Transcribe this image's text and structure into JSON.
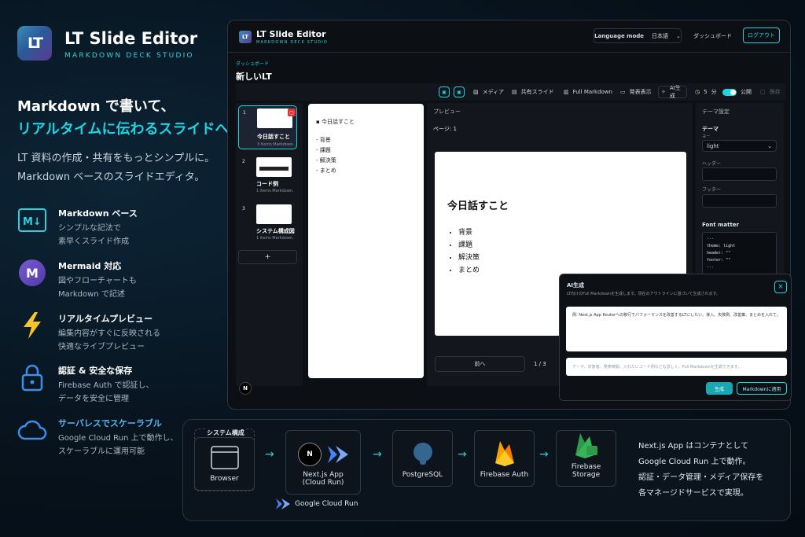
{
  "brand": {
    "title": "LT Slide Editor",
    "subtitle": "MARKDOWN DECK STUDIO",
    "logo": "LT"
  },
  "hero": {
    "line1": "Markdown で書いて、",
    "line2": "リアルタイムに伝わるスライドへ",
    "lead1": "LT 資料の作成・共有をもっとシンプルに。",
    "lead2": "Markdown ベースのスライドエディタ。"
  },
  "features": [
    {
      "title": "Markdown ベース",
      "d1": "シンプルな記法で",
      "d2": "素早くスライド作成",
      "icon": "markdown-icon"
    },
    {
      "title": "Mermaid 対応",
      "d1": "図やフローチャートも",
      "d2": "Markdown で記述",
      "icon": "mermaid-icon"
    },
    {
      "title": "リアルタイムプレビュー",
      "d1": "編集内容がすぐに反映される",
      "d2": "快適なライブプレビュー",
      "icon": "lightning-icon"
    },
    {
      "title": "認証 & 安全な保存",
      "d1": "Firebase Auth で認証し、",
      "d2": "データを安全に管理",
      "icon": "lock-icon"
    },
    {
      "title": "サーバレスでスケーラブル",
      "d1": "Google Cloud Run 上で動作し、",
      "d2": "スケーラブルに運用可能",
      "icon": "cloud-icon"
    }
  ],
  "app": {
    "title": "LT Slide Editor",
    "subtitle": "MARKDOWN DECK STUDIO",
    "language_label": "Language mode",
    "language_value": "日本語",
    "dashboard": "ダッシュボード",
    "logout": "ログアウト",
    "breadcrumb": "ダッシュボード",
    "page_title": "新しいLT",
    "toolbar": {
      "media": "メディア",
      "share": "共有スライド",
      "full_md": "Full Markdown",
      "present": "発表表示",
      "ai": "AI生成",
      "minutes": "5",
      "minutes_unit": "分",
      "public": "公開",
      "save": "保存"
    },
    "thumbs": [
      {
        "num": "1",
        "title": "今日話すこと",
        "meta": "3 items Markdown."
      },
      {
        "num": "2",
        "title": "コード例",
        "meta": "1 items Markdown."
      },
      {
        "num": "3",
        "title": "システム構成図",
        "meta": "1 items Markdown."
      }
    ],
    "add": "+",
    "n_badge": "N",
    "editor": {
      "heading": "今日話すこと",
      "items": [
        "背景",
        "課題",
        "解決策",
        "まとめ"
      ]
    },
    "preview": {
      "label": "プレビュー",
      "page": "ページ: 1",
      "title": "今日話すこと",
      "items": [
        "背景",
        "課題",
        "解決策",
        "まとめ"
      ],
      "prev": "前へ",
      "counter": "1 / 3"
    },
    "theme": {
      "heading": "テーマ設定",
      "theme_label": "テーマ",
      "theme_hint": "ヨー",
      "theme_value": "light",
      "header_label": "ヘッダー",
      "footer_label": "フッター",
      "fm_label": "Font matter",
      "fm_lines": [
        "---",
        "theme: light",
        "header: \"\"",
        "footer: \"\"",
        "---"
      ]
    },
    "ai_dialog": {
      "title": "AI生成",
      "desc": "LT向けのFull Markdownを生成します。現在のアウトラインに基づいて生成されます。",
      "prompt": "例: Next.js App Routerへの移行でパフォーマンスを改善するLTにしたい。導入、失敗例、改善策、まとめを入れて。",
      "hint": "テーマ、対象者、発表時間、入れたいコード例なども詳しく。Full Markdownを生成できます。",
      "generate": "生成",
      "apply": "Markdownに適用",
      "close": "×"
    }
  },
  "arch": {
    "label": "システム構成",
    "nodes": [
      {
        "name": "Browser",
        "icon": "browser-icon"
      },
      {
        "name": "Next.js App",
        "sub": "(Cloud Run)",
        "icon": "nextjs-icon"
      },
      {
        "name": "PostgreSQL",
        "icon": "postgresql-icon"
      },
      {
        "name": "Firebase Auth",
        "icon": "firebase-icon"
      },
      {
        "name": "Firebase Storage",
        "icon": "firebase-storage-icon"
      }
    ],
    "cloud_run": "Google Cloud Run",
    "note": [
      "Next.js App はコンテナとして",
      "Google Cloud Run 上で動作。",
      "認証・データ管理・メディア保存を",
      "各マネージドサービスで実現。"
    ]
  },
  "colors": {
    "accent": "#1fd4e0",
    "bg": "#07121c",
    "active": "#20c4cf"
  }
}
